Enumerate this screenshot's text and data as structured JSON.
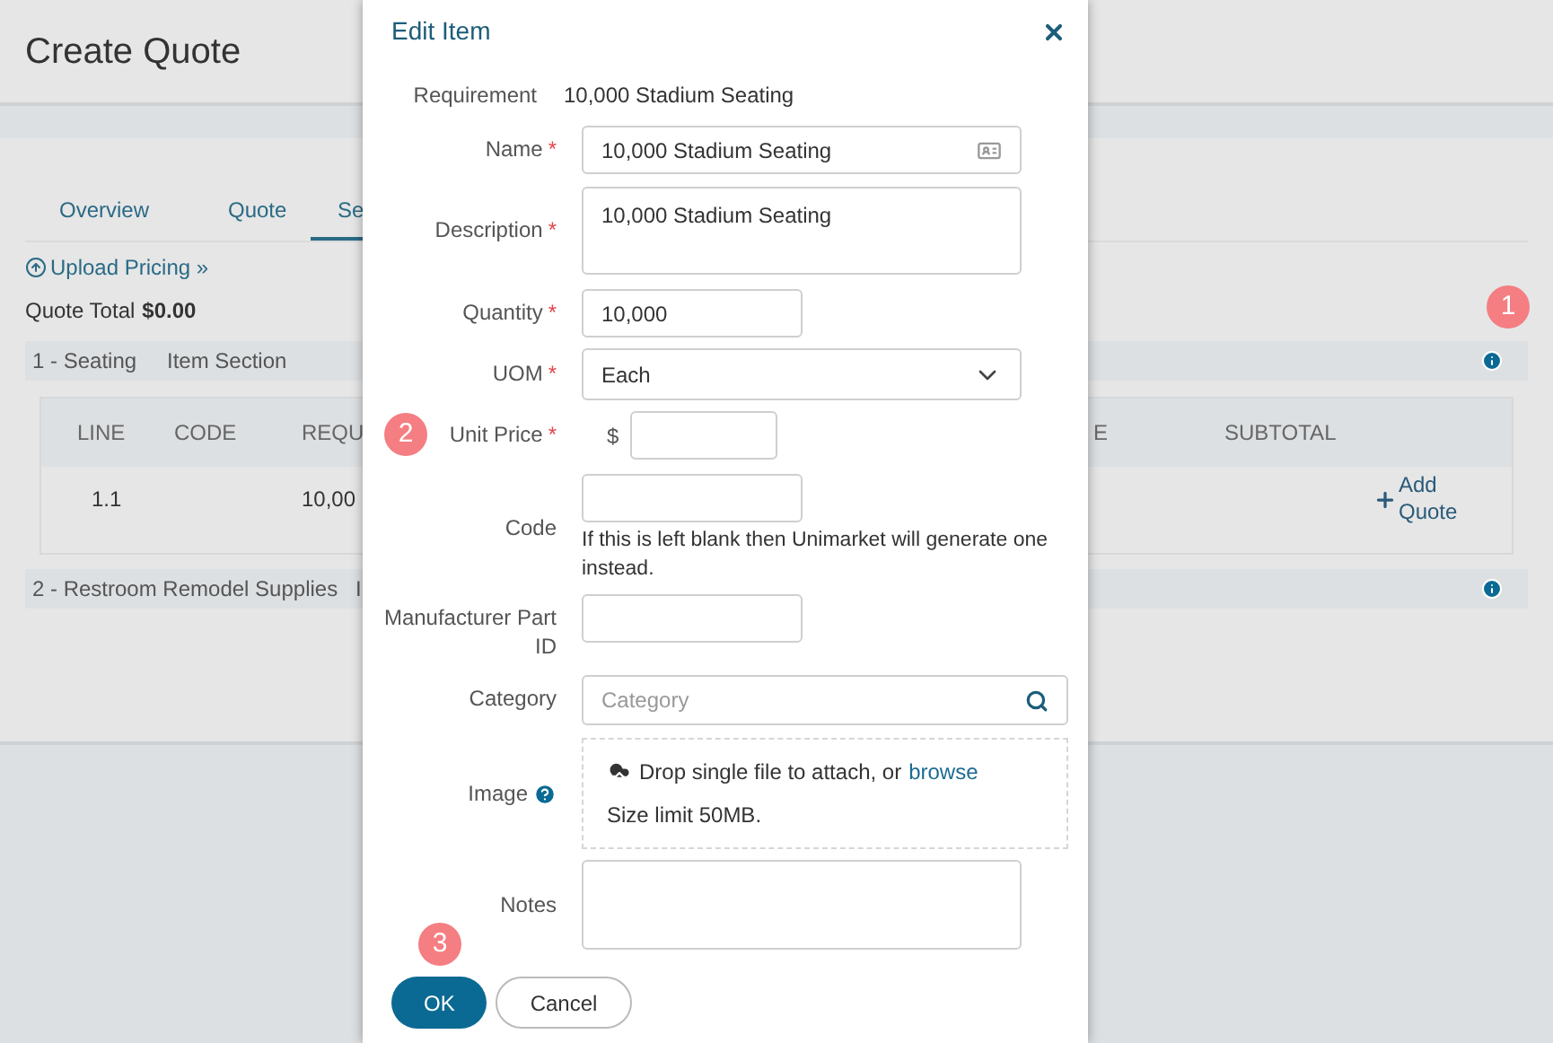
{
  "page": {
    "title": "Create Quote",
    "tabs": [
      {
        "label": "Overview",
        "selected": false
      },
      {
        "label": "Quote",
        "selected": false
      },
      {
        "label": "Se",
        "selected": true
      }
    ],
    "upload_link": "Upload Pricing »",
    "quote_total": {
      "label": "Quote Total",
      "value": "$0.00",
      "callout": "1"
    },
    "sections": [
      {
        "name": "1 - Seating",
        "type": "Item Section",
        "table": {
          "columns": [
            "LINE",
            "CODE",
            "REQU",
            "E",
            "SUBTOTAL"
          ],
          "rows": [
            {
              "line": "1.1",
              "column_3": "10,00",
              "action": "Add Quote"
            }
          ]
        }
      },
      {
        "name": "2 - Restroom Remodel Supplies",
        "type": "I"
      }
    ]
  },
  "modal": {
    "title": "Edit Item",
    "requirement": {
      "label": "Requirement",
      "value": "10,000 Stadium Seating"
    },
    "fields": [
      {
        "kind": "card_text",
        "label": "Name",
        "marker": "*",
        "value": "10,000 Stadium Seating"
      },
      {
        "kind": "textarea",
        "label": "Description",
        "marker": "*",
        "value": "10,000 Stadium Seating"
      },
      {
        "kind": "short_text",
        "label": "Quantity",
        "marker": "*",
        "value": "10,000"
      },
      {
        "kind": "select",
        "label": "UOM",
        "marker": "*",
        "value": "Each"
      },
      {
        "kind": "price",
        "label": "Unit Price",
        "marker": "*",
        "currency": "$",
        "callout": "2"
      },
      {
        "kind": "short_text",
        "label": "Code",
        "hint": "If this is left blank then Unimarket will generate one instead."
      },
      {
        "kind": "short_text",
        "label": "Manufacturer Part ID"
      },
      {
        "kind": "search",
        "label": "Category",
        "placeholder": "Category"
      },
      {
        "kind": "dropzone",
        "label": "Image",
        "help": true,
        "prompt": "Drop single file to attach, or",
        "link": "browse",
        "limit": "Size limit 50MB."
      },
      {
        "kind": "notes",
        "label": "Notes"
      }
    ],
    "buttons": [
      {
        "label": "OK",
        "kind": "primary",
        "callout": "3"
      },
      {
        "label": "Cancel",
        "kind": "secondary"
      }
    ]
  }
}
